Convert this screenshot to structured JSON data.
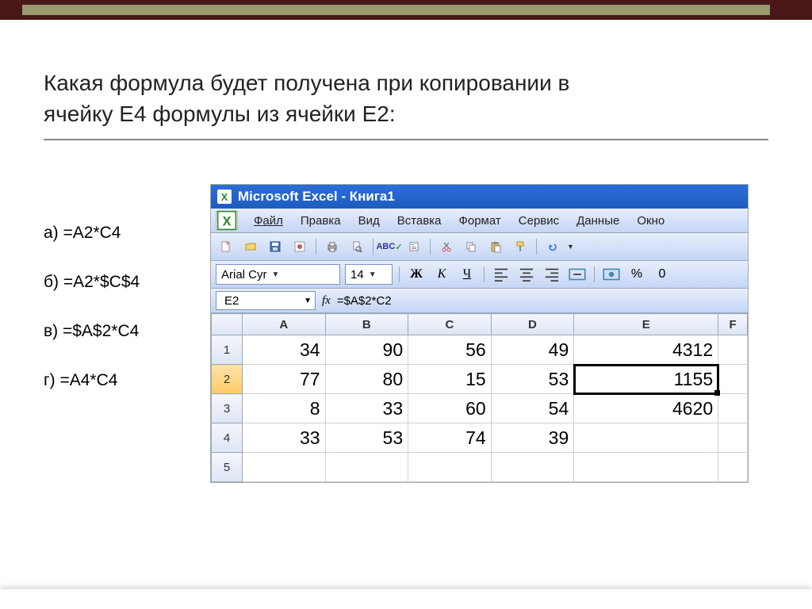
{
  "question": {
    "line1": "Какая формула будет получена при копировании в",
    "line2": "ячейку E4 формулы из ячейки E2:"
  },
  "answers": {
    "a": "а) =A2*C4",
    "b": "б) =A2*$C$4",
    "c": "в) =$A$2*C4",
    "d": "г) =A4*C4"
  },
  "excel": {
    "title": "Microsoft Excel - Книга1",
    "menu": {
      "file": "Файл",
      "edit": "Правка",
      "view": "Вид",
      "insert": "Вставка",
      "format": "Формат",
      "tools": "Сервис",
      "data": "Данные",
      "window": "Окно"
    },
    "font_name": "Arial Cyr",
    "font_size": "14",
    "bold": "Ж",
    "italic": "К",
    "underline": "Ч",
    "percent": "%",
    "zero": "0",
    "name_box": "E2",
    "fx": "fx",
    "formula": "=$A$2*C2",
    "columns": [
      "A",
      "B",
      "C",
      "D",
      "E",
      "F"
    ],
    "rows": [
      {
        "n": "1",
        "A": "34",
        "B": "90",
        "C": "56",
        "D": "49",
        "E": "4312",
        "F": ""
      },
      {
        "n": "2",
        "A": "77",
        "B": "80",
        "C": "15",
        "D": "53",
        "E": "1155",
        "F": ""
      },
      {
        "n": "3",
        "A": "8",
        "B": "33",
        "C": "60",
        "D": "54",
        "E": "4620",
        "F": ""
      },
      {
        "n": "4",
        "A": "33",
        "B": "53",
        "C": "74",
        "D": "39",
        "E": "",
        "F": ""
      },
      {
        "n": "5",
        "A": "",
        "B": "",
        "C": "",
        "D": "",
        "E": "",
        "F": ""
      }
    ]
  }
}
